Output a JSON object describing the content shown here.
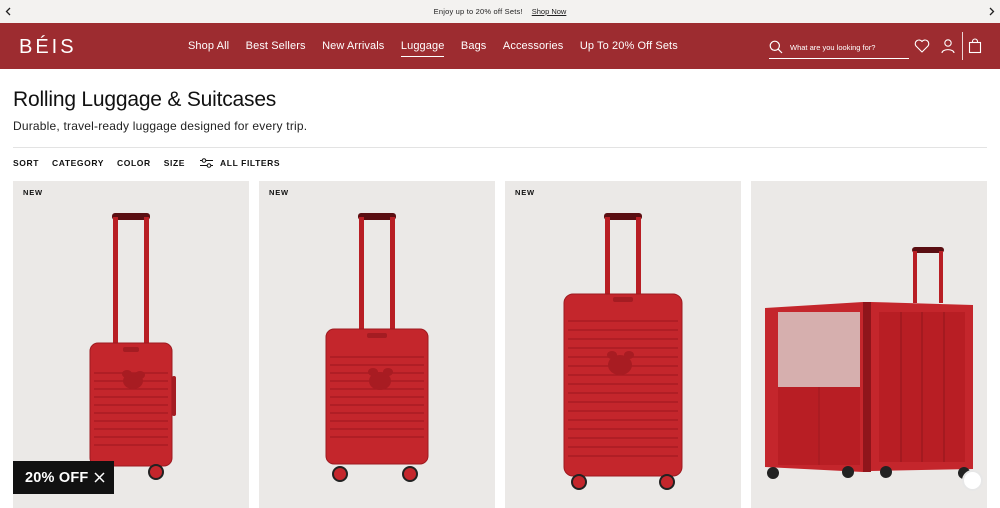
{
  "announcement": {
    "message": "Enjoy up to 20% off Sets!",
    "link": "Shop Now",
    "prev_icon": "chevron-left-icon",
    "next_icon": "chevron-right-icon"
  },
  "header": {
    "logo": "BÉIS",
    "brand_color": "#9d2c30",
    "nav": [
      "Shop All",
      "Best Sellers",
      "New Arrivals",
      "Luggage",
      "Bags",
      "Accessories",
      "Up To 20% Off Sets"
    ],
    "active_nav": "Luggage",
    "search_placeholder": "What are you looking for?",
    "icons": [
      "search-icon",
      "heart-icon",
      "account-icon",
      "bag-icon"
    ]
  },
  "page": {
    "title": "Rolling Luggage & Suitcases",
    "subtitle": "Durable, travel-ready luggage designed for every trip."
  },
  "filters": {
    "sort": "SORT",
    "category": "CATEGORY",
    "color": "COLOR",
    "size": "SIZE",
    "all_filters": "ALL FILTERS"
  },
  "products": [
    {
      "badge": "NEW",
      "image": "red carry-on suitcase with Mickey emboss, handle extended"
    },
    {
      "badge": "NEW",
      "image": "red carry-on suitcase with Mickey emboss, front view"
    },
    {
      "badge": "NEW",
      "image": "red medium check-in suitcase with Mickey emboss"
    },
    {
      "badge": "",
      "image": "red suitcase opened showing interior"
    }
  ],
  "promo": {
    "label": "20% OFF",
    "close_icon": "close-icon"
  }
}
